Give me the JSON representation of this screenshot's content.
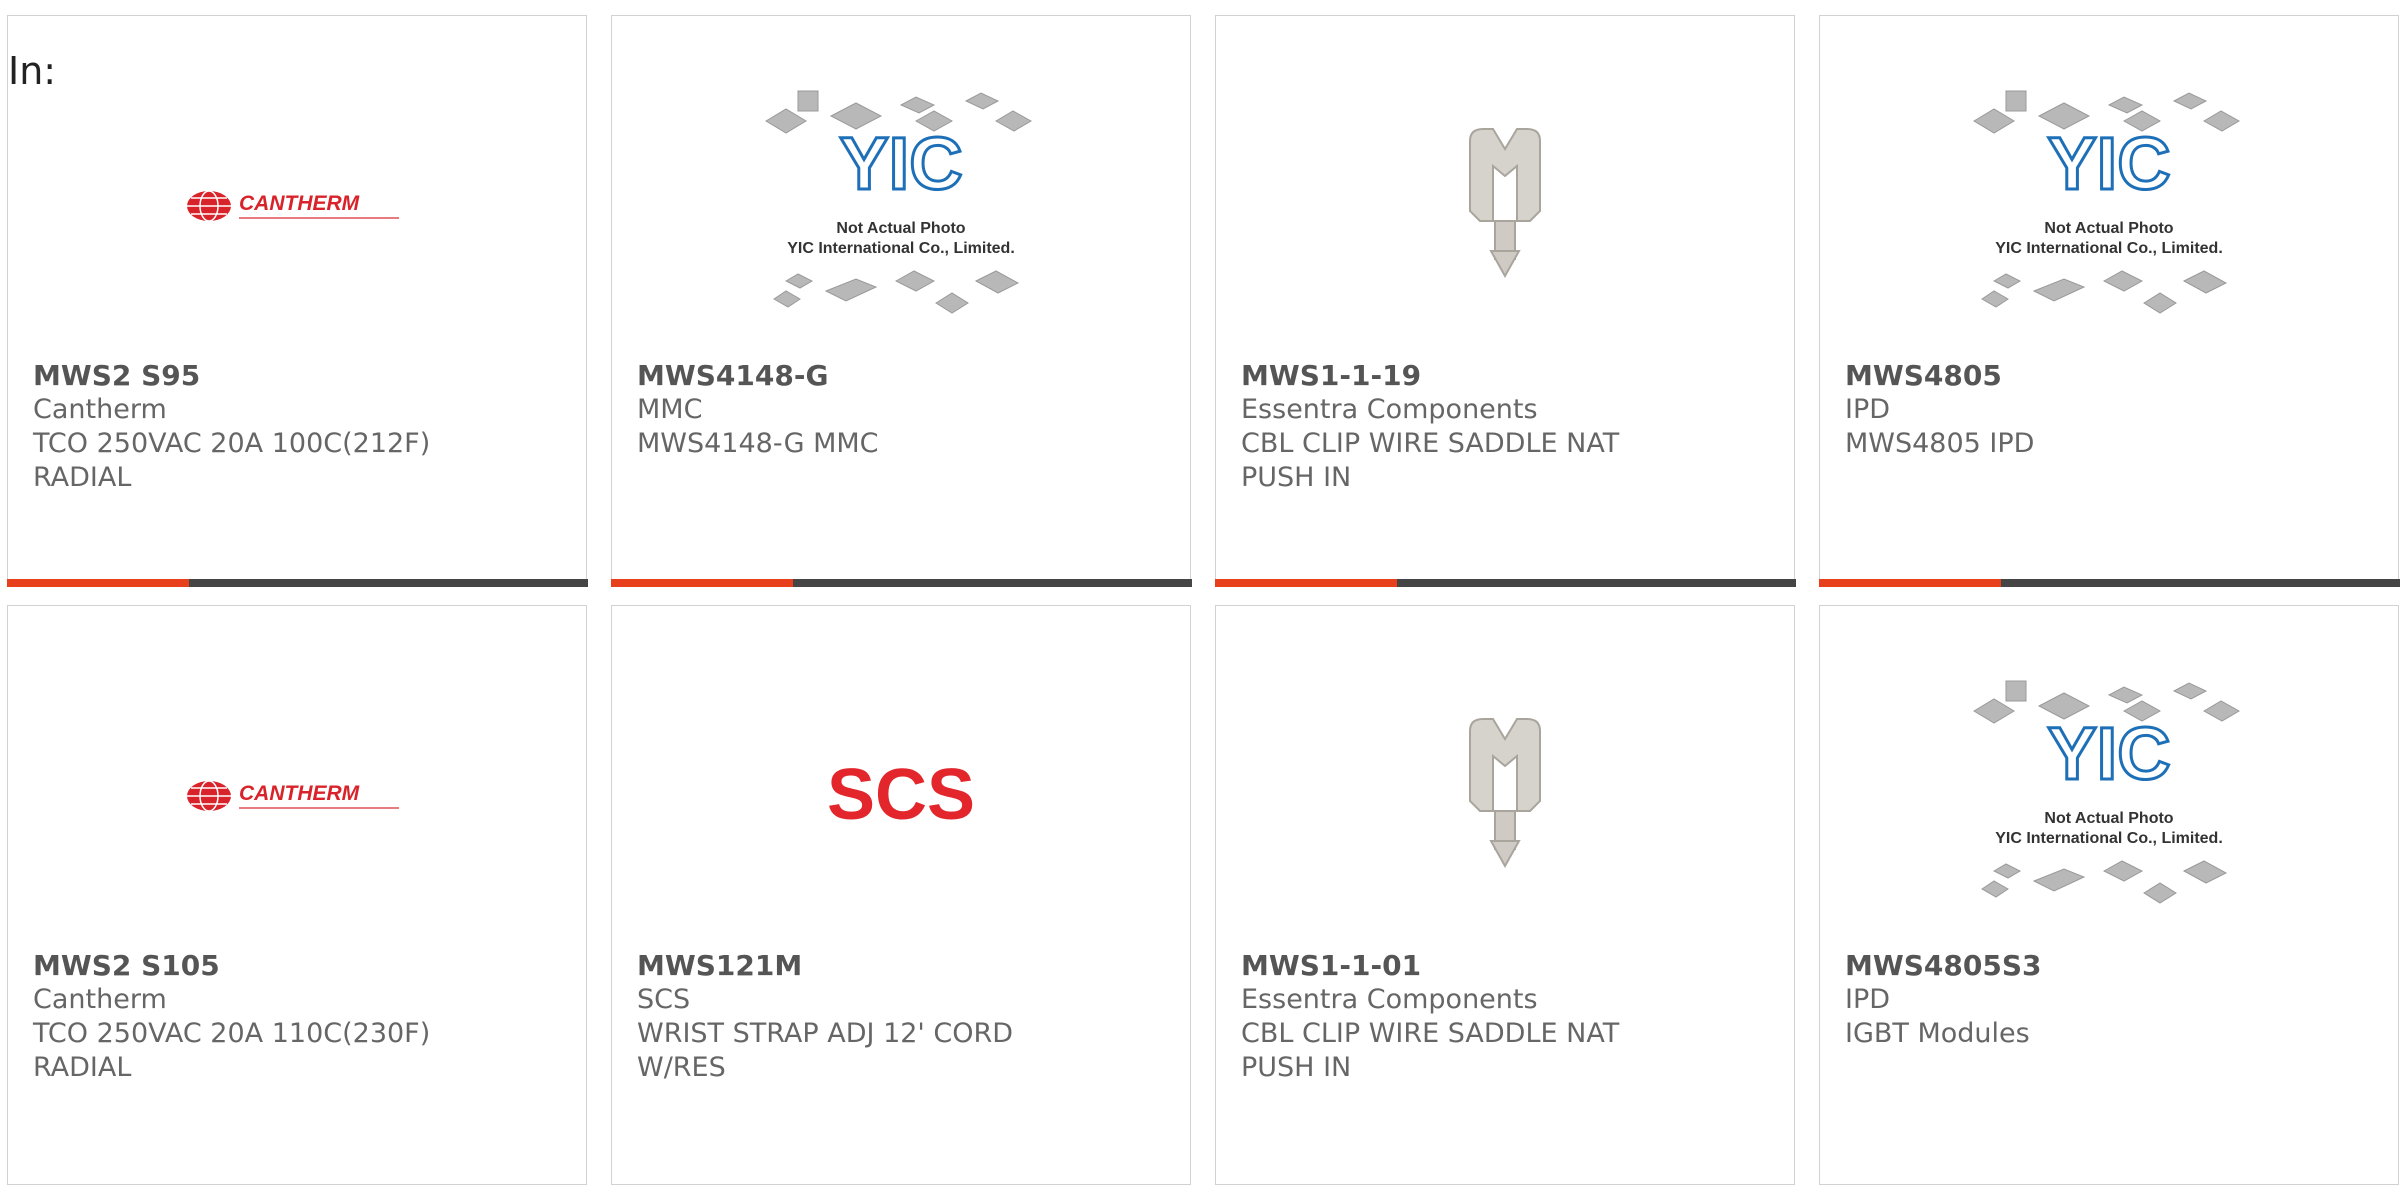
{
  "filter_label": "In:",
  "colors": {
    "accent": "#e8401c",
    "bar": "#454545",
    "card_border": "#d2d2d2",
    "text": "#555555"
  },
  "products": [
    {
      "part_number": "MWS2 S95",
      "manufacturer": "Cantherm",
      "description": [
        "TCO 250VAC 20A 100C(212F)",
        "RADIAL"
      ],
      "image": "cantherm-logo",
      "logo_text": "CANTHERM"
    },
    {
      "part_number": "MWS4148-G",
      "manufacturer": "MMC",
      "description": [
        "MWS4148-G MMC"
      ],
      "image": "yic-placeholder",
      "photo_note": "Not Actual Photo",
      "photo_company": "YIC International Co., Limited."
    },
    {
      "part_number": "MWS1-1-19",
      "manufacturer": "Essentra Components",
      "description": [
        "CBL CLIP WIRE SADDLE NAT",
        "PUSH IN"
      ],
      "image": "cable-clip"
    },
    {
      "part_number": "MWS4805",
      "manufacturer": "IPD",
      "description": [
        "MWS4805 IPD"
      ],
      "image": "yic-placeholder",
      "photo_note": "Not Actual Photo",
      "photo_company": "YIC International Co., Limited."
    },
    {
      "part_number": "MWS2 S105",
      "manufacturer": "Cantherm",
      "description": [
        "TCO 250VAC 20A 110C(230F)",
        "RADIAL"
      ],
      "image": "cantherm-logo",
      "logo_text": "CANTHERM"
    },
    {
      "part_number": "MWS121M",
      "manufacturer": "SCS",
      "description": [
        "WRIST STRAP ADJ 12' CORD",
        "W/RES"
      ],
      "image": "scs-logo",
      "logo_text": "SCS"
    },
    {
      "part_number": "MWS1-1-01",
      "manufacturer": "Essentra Components",
      "description": [
        "CBL CLIP WIRE SADDLE NAT",
        "PUSH IN"
      ],
      "image": "cable-clip"
    },
    {
      "part_number": "MWS4805S3",
      "manufacturer": "IPD",
      "description": [
        "IGBT Modules"
      ],
      "image": "yic-placeholder",
      "photo_note": "Not Actual Photo",
      "photo_company": "YIC International Co., Limited."
    }
  ]
}
